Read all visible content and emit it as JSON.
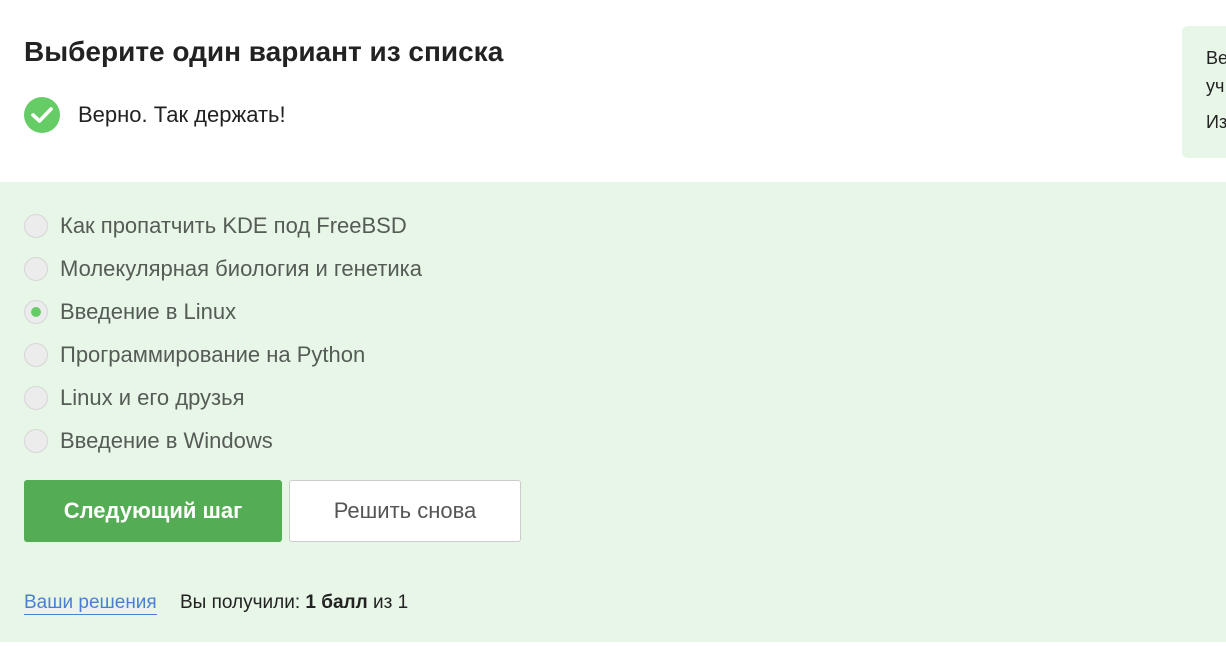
{
  "quiz": {
    "title": "Выберите один вариант из списка",
    "feedback": "Верно. Так держать!"
  },
  "side_panel": {
    "line1": "Ве",
    "line2": "уч",
    "line3": "Из"
  },
  "options": [
    {
      "label": "Как пропатчить KDE под FreeBSD",
      "selected": false
    },
    {
      "label": "Молекулярная биология и генетика",
      "selected": false
    },
    {
      "label": "Введение в Linux",
      "selected": true
    },
    {
      "label": "Программирование на Python",
      "selected": false
    },
    {
      "label": "Linux и его друзья",
      "selected": false
    },
    {
      "label": "Введение в Windows",
      "selected": false
    }
  ],
  "buttons": {
    "next_label": "Следующий шаг",
    "retry_label": "Решить снова"
  },
  "footer": {
    "solutions_link": "Ваши решения",
    "score_prefix": "Вы получили:",
    "score_value": "1 балл",
    "score_suffix": "из 1"
  },
  "colors": {
    "accent_green": "#54ad54",
    "check_green": "#66cc66",
    "answer_bg": "#e8f6e8",
    "link_blue": "#4a7fd4"
  },
  "icons": {
    "feedback": "check-circle-icon"
  }
}
